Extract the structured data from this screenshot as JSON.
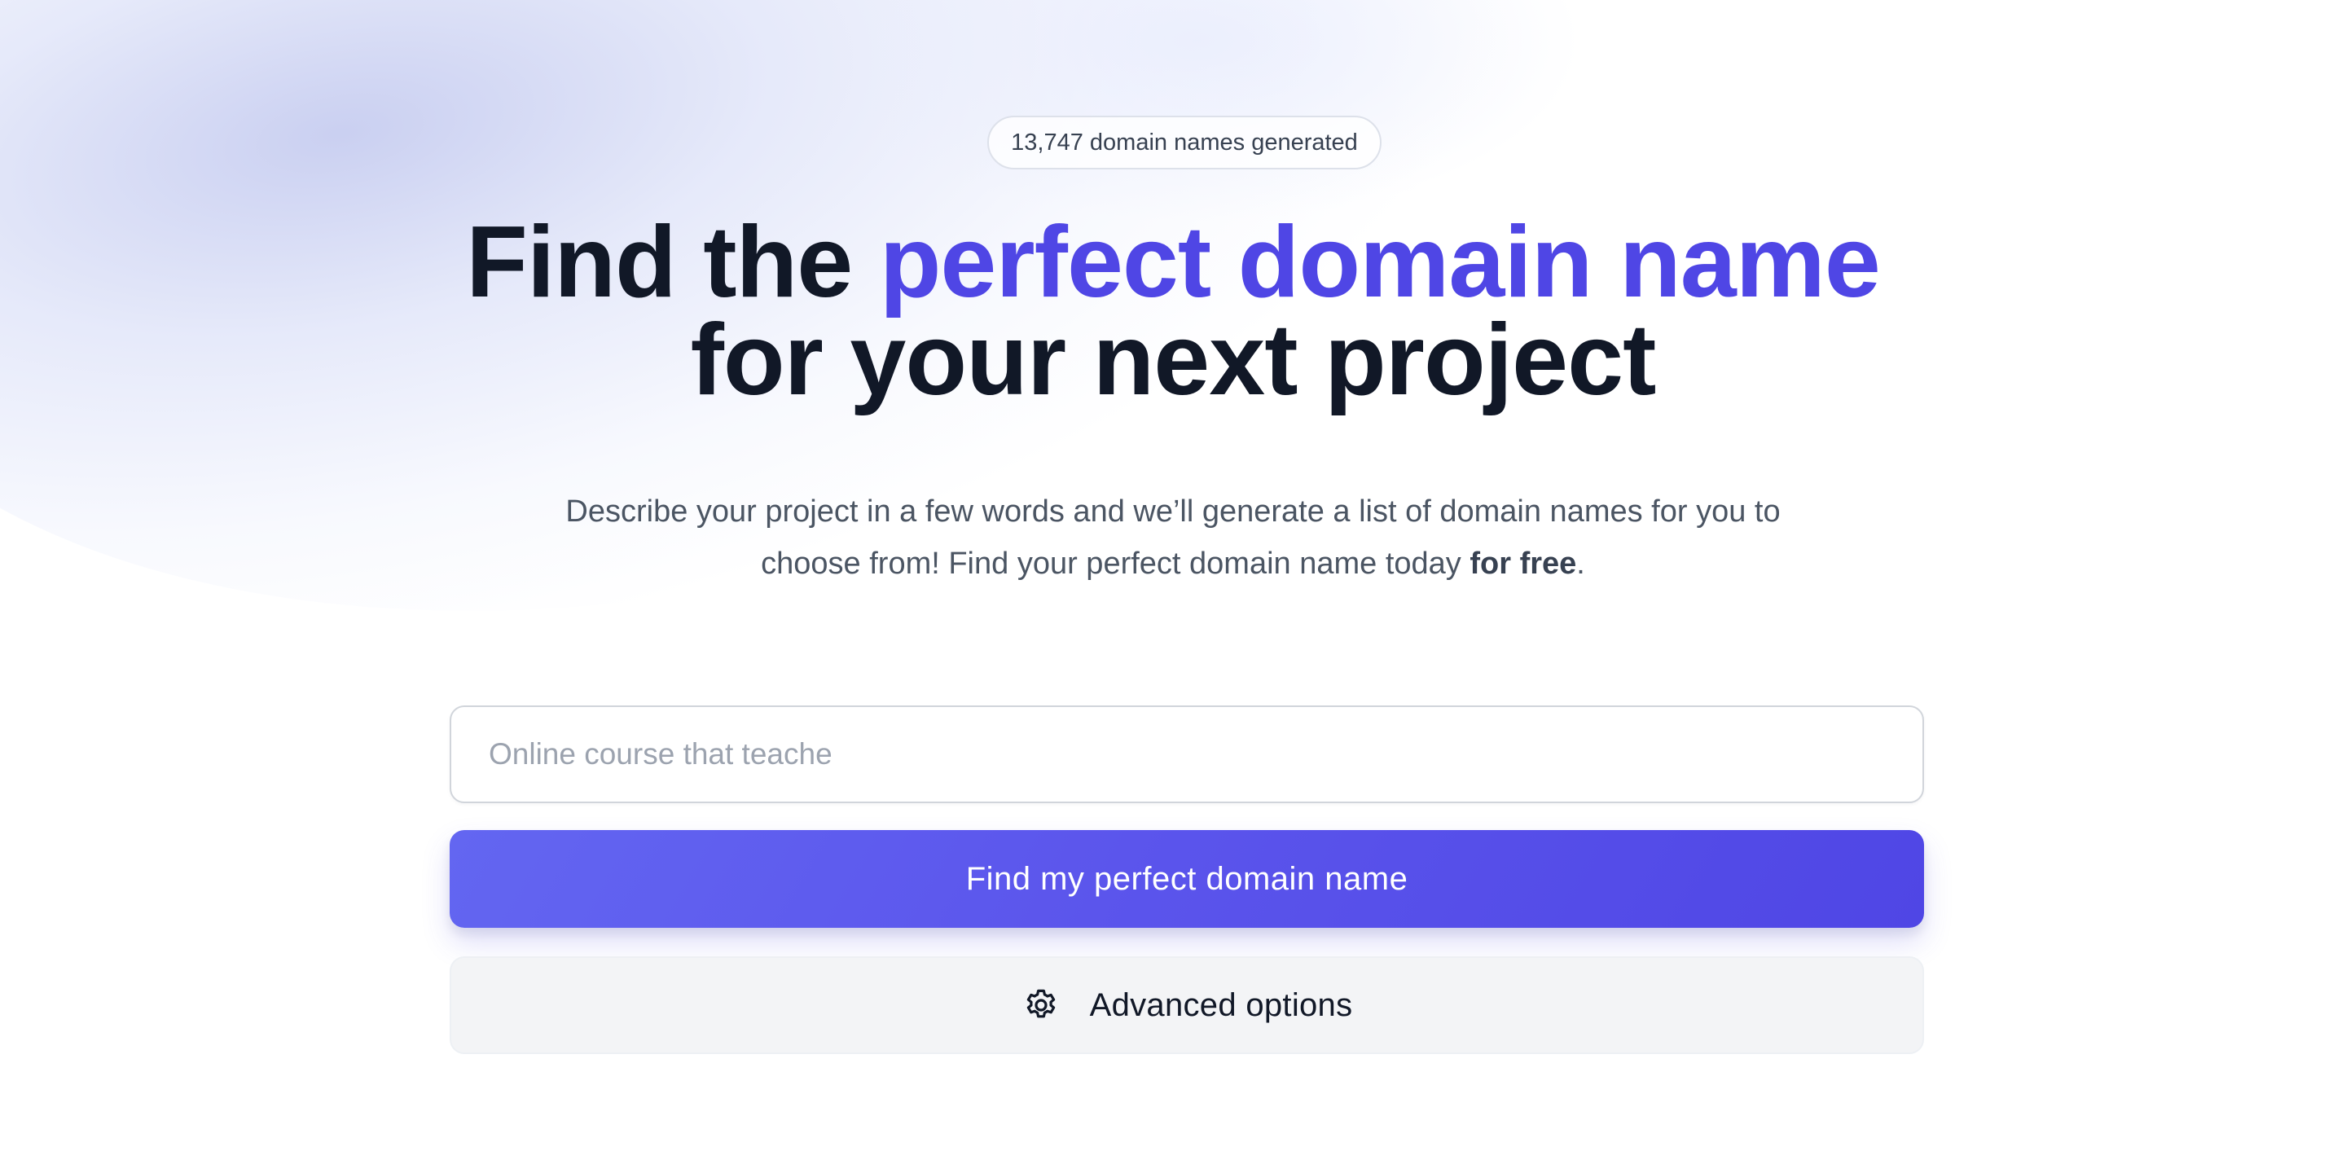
{
  "counter": {
    "text": "13,747 domain names generated"
  },
  "hero": {
    "title_prefix": "Find the ",
    "title_accent": "perfect domain name",
    "title_line_2": "for your next project",
    "description_line_1": "Describe your project in a few words and we’ll generate a list of domain names for you to",
    "description_line_2_start": "choose from! Find your perfect domain name today ",
    "description_line_2_bold": "for free",
    "description_line_2_end": "."
  },
  "search": {
    "placeholder": "Online course that teache"
  },
  "actions": {
    "primary_label": "Find my perfect domain name",
    "advanced_label": "Advanced options",
    "advanced_icon": "gear-icon"
  },
  "colors": {
    "accent": "#4f46e5",
    "heading": "#111827",
    "body_text": "#4b5563",
    "secondary_button": "#f3f4f6"
  }
}
